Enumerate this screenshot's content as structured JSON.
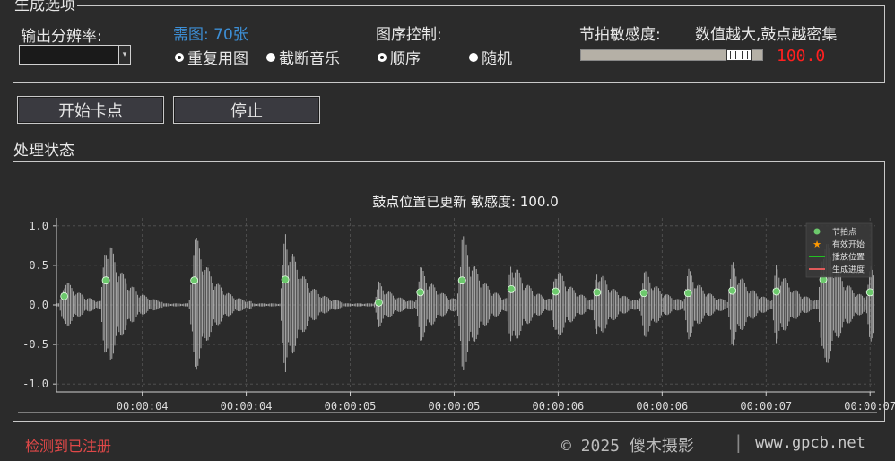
{
  "settings": {
    "group_title": "生成选项",
    "resolution_label": "输出分辨率:",
    "resolution_value": "",
    "need_images": "需图: 70张",
    "radio_repeat": "重复用图",
    "radio_cut": "截断音乐",
    "order_label": "图序控制:",
    "radio_order": "顺序",
    "radio_random": "随机",
    "sensitivity_label": "节拍敏感度:",
    "sensitivity_hint": "数值越大,鼓点越密集",
    "sensitivity_value": "100.0",
    "sensitivity_level": 0.93
  },
  "actions": {
    "start_label": "开始卡点",
    "stop_label": "停止"
  },
  "status": {
    "group_title": "处理状态"
  },
  "chart_data": {
    "type": "line",
    "title": "鼓点位置已更新 敏感度: 100.0",
    "ylim": [
      -1.1,
      1.1
    ],
    "yticks": [
      "1.0",
      "0.5",
      "0.0",
      "-0.5",
      "-1.0"
    ],
    "ytick_values": [
      1.0,
      0.5,
      0.0,
      -0.5,
      -1.0
    ],
    "xtick_labels": [
      "00:00:04",
      "00:00:04",
      "00:00:05",
      "00:00:05",
      "00:00:06",
      "00:00:06",
      "00:00:07",
      "00:00:07"
    ],
    "xtick_positions": [
      4.05,
      4.45,
      4.85,
      5.25,
      5.65,
      6.05,
      6.45,
      6.85
    ],
    "xlim": [
      3.72,
      6.87
    ],
    "grid": true,
    "legend": [
      "节拍点",
      "有效开始",
      "播放位置",
      "生成进度"
    ],
    "legend_placement": "top-right",
    "colors": {
      "waveform": "#cfcfcf",
      "beat": "#6cc96c",
      "start": "#ff9900",
      "play": "#22c022",
      "progress": "#e05a5a"
    },
    "beats": [
      {
        "t": 3.75,
        "v": 0.11
      },
      {
        "t": 3.91,
        "v": 0.31
      },
      {
        "t": 4.25,
        "v": 0.31
      },
      {
        "t": 4.6,
        "v": 0.32
      },
      {
        "t": 4.96,
        "v": 0.03
      },
      {
        "t": 5.12,
        "v": 0.16
      },
      {
        "t": 5.28,
        "v": 0.31
      },
      {
        "t": 5.47,
        "v": 0.2
      },
      {
        "t": 5.64,
        "v": 0.17
      },
      {
        "t": 5.8,
        "v": 0.16
      },
      {
        "t": 5.98,
        "v": 0.15
      },
      {
        "t": 6.15,
        "v": 0.15
      },
      {
        "t": 6.32,
        "v": 0.18
      },
      {
        "t": 6.49,
        "v": 0.17
      },
      {
        "t": 6.67,
        "v": 0.32
      },
      {
        "t": 6.85,
        "v": 0.16
      }
    ]
  },
  "footer": {
    "registered": "检测到已注册",
    "copyright": "© 2025 傻木摄影",
    "separator": "|",
    "website": "www.gpcb.net"
  }
}
